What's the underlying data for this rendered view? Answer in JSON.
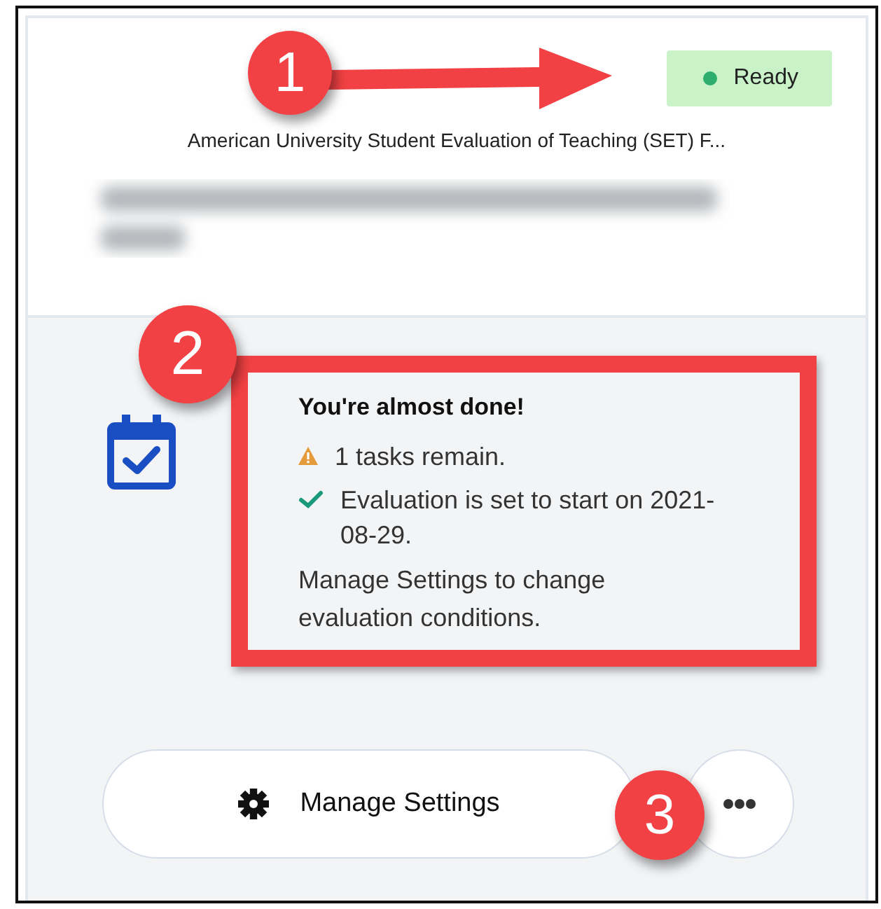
{
  "status_badge": {
    "label": "Ready",
    "color": "#2eae6e"
  },
  "title": "American University Student Evaluation of Teaching (SET) F...",
  "notice": {
    "heading": "You're almost done!",
    "items": [
      {
        "kind": "warning",
        "text": "1 tasks remain."
      },
      {
        "kind": "success",
        "text": "Evaluation is set to start on 2021-08-29."
      }
    ],
    "note": "Manage Settings to change evaluation conditions."
  },
  "buttons": [
    {
      "kind": "settings",
      "label": "Manage Settings"
    },
    {
      "kind": "more"
    }
  ],
  "markers": [
    {
      "number": "1"
    },
    {
      "number": "2"
    },
    {
      "number": "3"
    }
  ]
}
